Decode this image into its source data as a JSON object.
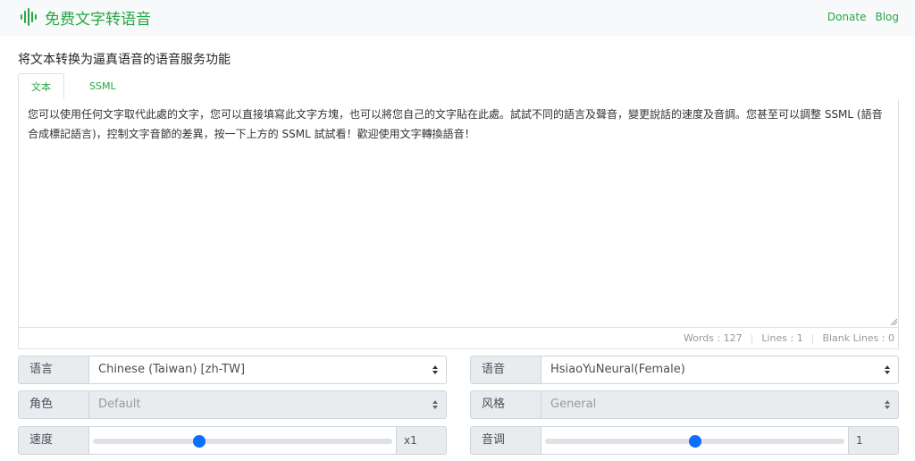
{
  "app": {
    "title": "免费文字转语音",
    "nav": [
      "Donate",
      "Blog"
    ]
  },
  "page_title": "将文本转换为逼真语音的语音服务功能",
  "tabs": [
    "文本",
    "SSML"
  ],
  "editor_text": "您可以使用任何文字取代此處的文字，您可以直接填寫此文字方塊，也可以將您自己的文字貼在此處。試試不同的語言及聲音，變更說話的速度及音調。您甚至可以調整 SSML (語音合成標記語言)，控制文字音節的差異，按一下上方的 SSML 試試看！歡迎使用文字轉換語音！",
  "stats": {
    "words": "Words : 127",
    "lines": "Lines : 1",
    "blank": "Blank Lines : 0"
  },
  "controls": {
    "language": {
      "label": "语言",
      "value": "Chinese (Taiwan) [zh-TW]"
    },
    "voice": {
      "label": "语音",
      "value": "HsiaoYuNeural(Female)"
    },
    "role": {
      "label": "角色",
      "value": "Default"
    },
    "style": {
      "label": "风格",
      "value": "General"
    },
    "speed": {
      "label": "速度",
      "value": "x1",
      "fraction": 0.35
    },
    "pitch": {
      "label": "音调",
      "value": "1",
      "fraction": 0.5
    }
  },
  "colors": {
    "accent": "#28a745",
    "slider": "#0d6efd"
  }
}
